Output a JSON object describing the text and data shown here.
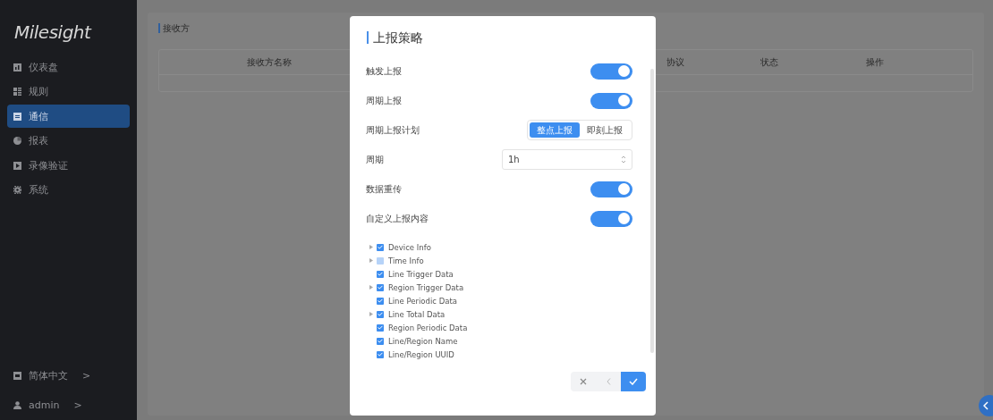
{
  "sidebar": {
    "logo": "Milesight",
    "items": [
      {
        "label": "仪表盘",
        "selected": false
      },
      {
        "label": "规则",
        "selected": false
      },
      {
        "label": "通信",
        "selected": true
      },
      {
        "label": "报表",
        "selected": false
      },
      {
        "label": "录像验证",
        "selected": false
      },
      {
        "label": "系统",
        "selected": false
      }
    ],
    "footer": [
      {
        "label": "简体中文",
        "arrow": ">"
      },
      {
        "label": "admin",
        "arrow": ">"
      }
    ]
  },
  "page": {
    "section_title": "接收方",
    "columns": [
      "接收方名称",
      "协议",
      "状态",
      "操作"
    ]
  },
  "dialog": {
    "title": "上报策略",
    "rows": [
      {
        "kind": "toggle",
        "label": "触发上报",
        "on": true
      },
      {
        "kind": "toggle",
        "label": "周期上报",
        "on": true
      },
      {
        "kind": "segmented",
        "label": "周期上报计划",
        "options": [
          {
            "label": "整点上报",
            "selected": true
          },
          {
            "label": "即刻上报",
            "selected": false
          }
        ]
      },
      {
        "kind": "number",
        "label": "周期",
        "value": "1h"
      },
      {
        "kind": "toggle",
        "label": "数据重传",
        "on": true
      },
      {
        "kind": "toggle",
        "label": "自定义上报内容",
        "on": true
      }
    ],
    "tree": [
      {
        "label": "Device Info",
        "checked": true,
        "collapsed": true
      },
      {
        "label": "Time Info",
        "checked": false,
        "collapsed": true
      },
      {
        "label": "Line Trigger Data",
        "checked": true,
        "collapsed": false
      },
      {
        "label": "Region Trigger Data",
        "checked": true,
        "collapsed": true
      },
      {
        "label": "Line Periodic Data",
        "checked": true,
        "collapsed": false
      },
      {
        "label": "Line Total Data",
        "checked": true,
        "collapsed": true
      },
      {
        "label": "Region Periodic Data",
        "checked": true,
        "collapsed": false
      },
      {
        "label": "Line/Region Name",
        "checked": true,
        "collapsed": false
      },
      {
        "label": "Line/Region UUID",
        "checked": true,
        "collapsed": false
      }
    ]
  }
}
